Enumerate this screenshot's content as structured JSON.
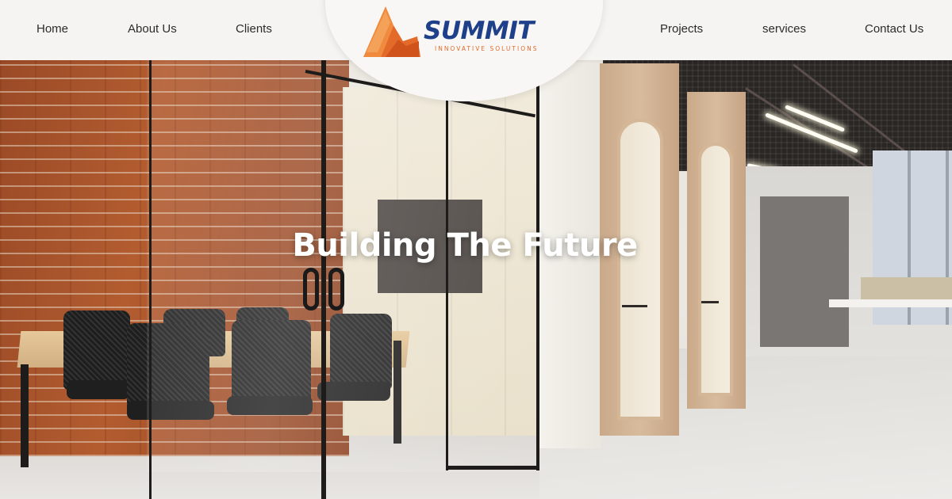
{
  "nav": {
    "items": [
      {
        "label": "Home"
      },
      {
        "label": "About Us"
      },
      {
        "label": "Clients"
      },
      {
        "label": "Projects"
      },
      {
        "label": "services"
      },
      {
        "label": "Contact Us"
      }
    ]
  },
  "logo": {
    "name": "SUMMIT",
    "tagline": "INNOVATIVE SOLUTIONS",
    "icon": "mountain-peak-logo-icon",
    "colors": {
      "primary": "#1e3f8a",
      "accent": "#e46a2a"
    }
  },
  "hero": {
    "headline": "Building The Future",
    "background": "office-interior-photo"
  }
}
